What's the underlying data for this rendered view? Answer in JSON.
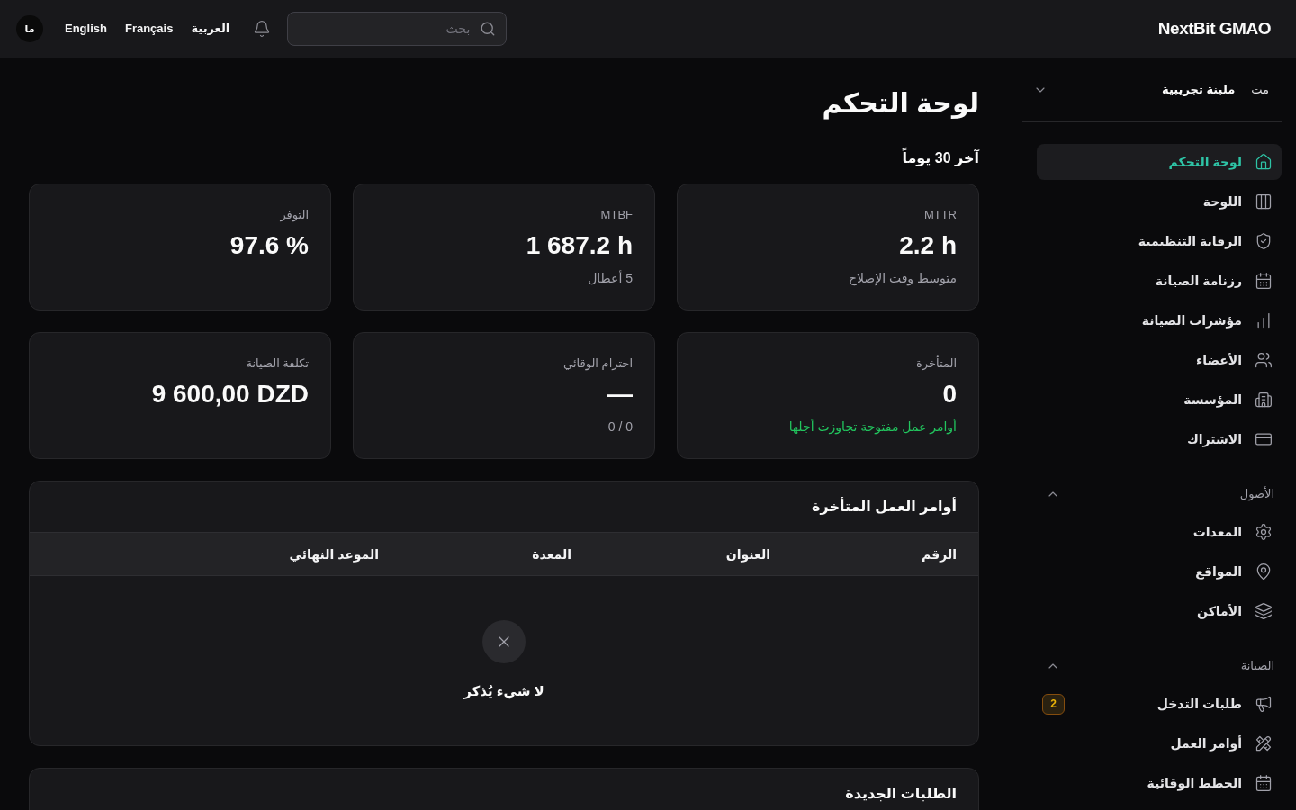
{
  "topbar": {
    "brand": "NextBit GMAO",
    "search": {
      "placeholder": "بحث"
    },
    "languages": [
      "العربية",
      "Français",
      "English"
    ],
    "avatar": "ما"
  },
  "sidebar": {
    "organization": {
      "initials": "مت",
      "name": "ملبنة تجريبية"
    },
    "items": [
      {
        "label": "لوحة التحكم",
        "selected": true
      },
      {
        "label": "اللوحة",
        "selected": false
      },
      {
        "label": "الرقابة التنظيمية",
        "selected": false
      },
      {
        "label": "رزنامة الصيانة",
        "selected": false
      },
      {
        "label": "مؤشرات الصيانة",
        "selected": false
      },
      {
        "label": "الأعضاء",
        "selected": false
      },
      {
        "label": "المؤسسة",
        "selected": false
      },
      {
        "label": "الاشتراك",
        "selected": false
      }
    ],
    "sections": [
      {
        "title": "الأصول",
        "expanded": true,
        "items": [
          {
            "label": "المعدات",
            "selected": false
          },
          {
            "label": "المواقع",
            "selected": false
          },
          {
            "label": "الأماكن",
            "selected": false
          }
        ]
      },
      {
        "title": "الصيانة",
        "expanded": true,
        "items": [
          {
            "label": "طلبات التدخل",
            "selected": false,
            "badge": "2"
          },
          {
            "label": "أوامر العمل",
            "selected": false
          },
          {
            "label": "الخطط الوقائية",
            "selected": false
          }
        ]
      }
    ]
  },
  "dashboard": {
    "title": "لوحة التحكم",
    "period": "آخر 30 يوماً",
    "kpis": [
      {
        "label": "MTTR",
        "value": "2.2 h",
        "note": {
          "text": "متوسط وقت الإصلاح",
          "color": "#a1a1aa"
        }
      },
      {
        "label": "MTBF",
        "value": "1 687.2 h",
        "note": {
          "text": "5 أعطال",
          "color": "#a1a1aa"
        }
      },
      {
        "label": "التوفر",
        "value": "97.6 %"
      },
      {
        "label": "المتأخرة",
        "value": "0",
        "note": {
          "text": "أوامر عمل مفتوحة تجاوزت أجلها",
          "color": "#22c55e"
        }
      },
      {
        "label": "احترام الوقائي",
        "value": "—",
        "note": {
          "text": "0 / 0",
          "color": "#a1a1aa"
        }
      },
      {
        "label": "تكلفة الصيانة",
        "value": "9 600,00 DZD"
      }
    ],
    "overdue_orders": {
      "title": "أوامر العمل المتأخرة",
      "columns": [
        "الرقم",
        "العنوان",
        "المعدة",
        "الموعد النهائي"
      ],
      "empty_message": "لا شيء يُذكر"
    },
    "new_requests": {
      "title": "الطلبات الجديدة"
    }
  }
}
